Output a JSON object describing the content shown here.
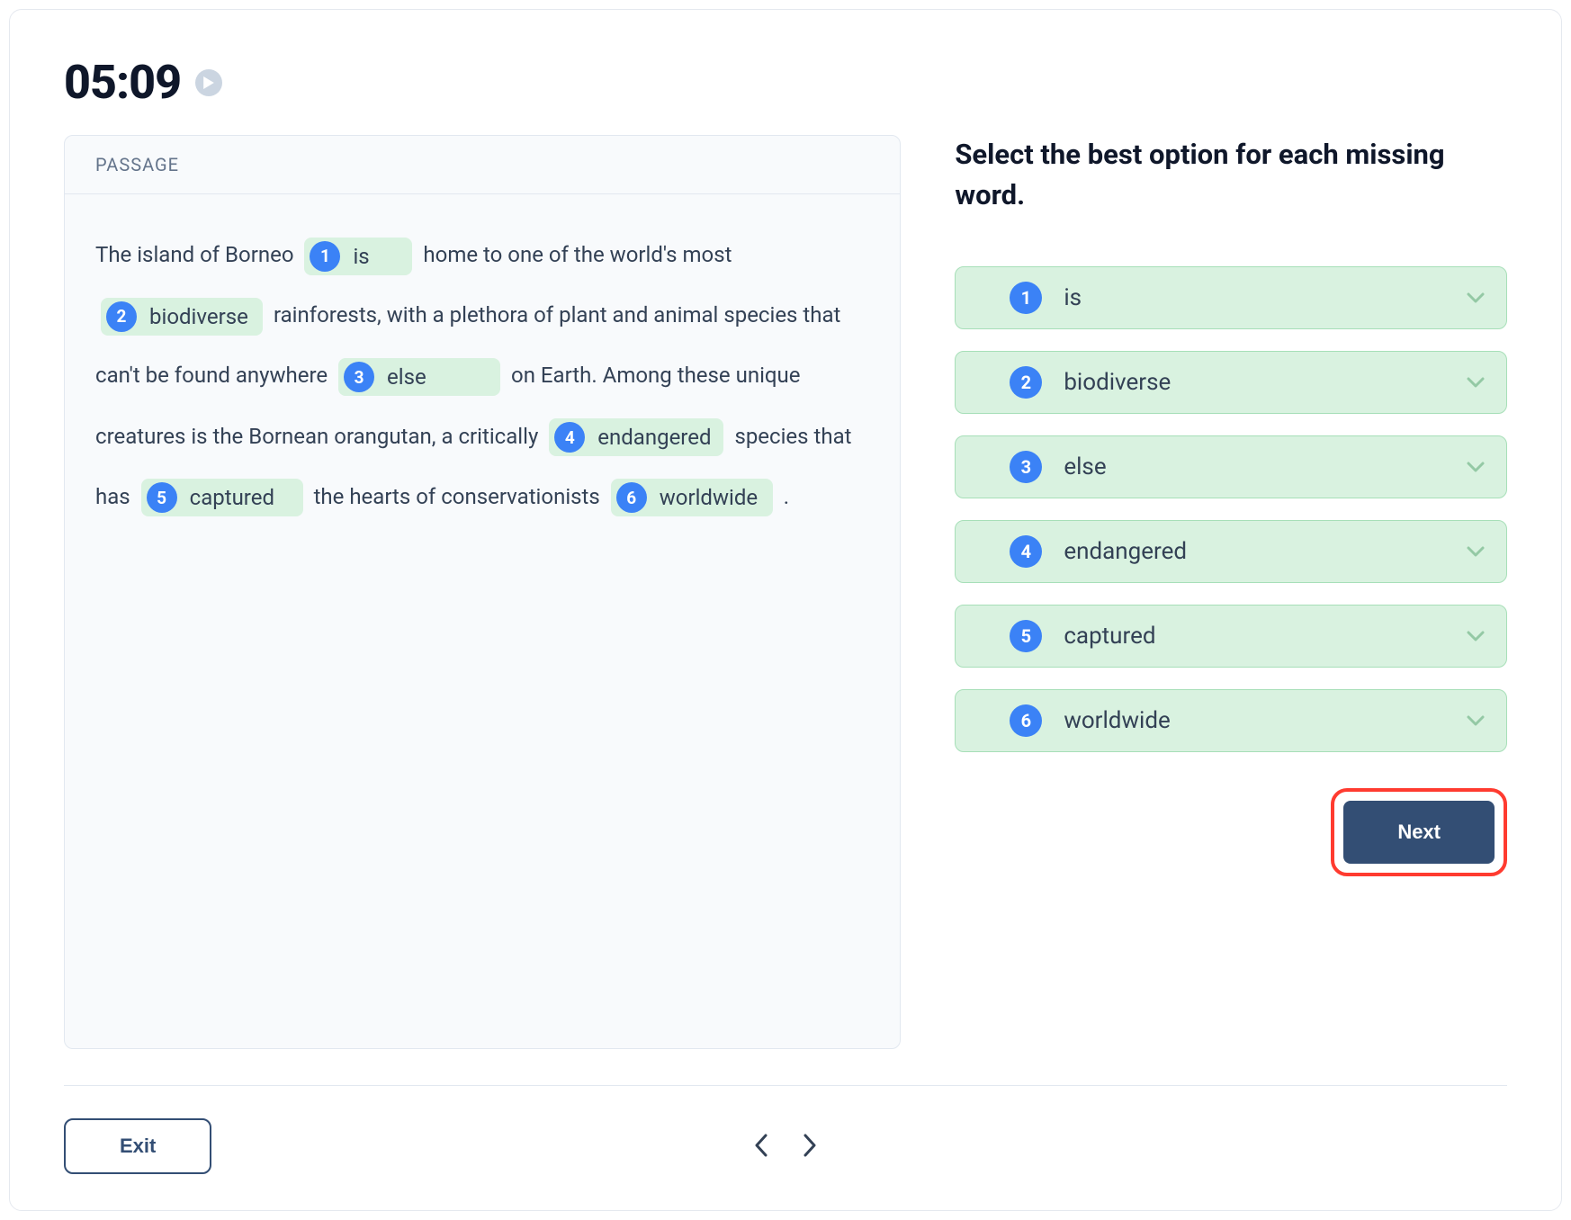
{
  "timer": "05:09",
  "passage_label": "PASSAGE",
  "passage": {
    "segments": [
      "The island of Borneo ",
      " home to one of the world's most ",
      " rainforests, with a plethora of plant and animal species that can't be found anywhere ",
      " on Earth. Among these unique creatures is the Bornean orangutan, a critically ",
      " species that has ",
      " the hearts of conservationists ",
      " ."
    ],
    "blanks": [
      {
        "n": "1",
        "word": "is"
      },
      {
        "n": "2",
        "word": "biodiverse"
      },
      {
        "n": "3",
        "word": "else"
      },
      {
        "n": "4",
        "word": "endangered"
      },
      {
        "n": "5",
        "word": "captured"
      },
      {
        "n": "6",
        "word": "worldwide"
      }
    ]
  },
  "instruction": "Select the best option for each missing word.",
  "options": [
    {
      "n": "1",
      "label": "is"
    },
    {
      "n": "2",
      "label": "biodiverse"
    },
    {
      "n": "3",
      "label": "else"
    },
    {
      "n": "4",
      "label": "endangered"
    },
    {
      "n": "5",
      "label": "captured"
    },
    {
      "n": "6",
      "label": "worldwide"
    }
  ],
  "buttons": {
    "next": "Next",
    "exit": "Exit"
  }
}
